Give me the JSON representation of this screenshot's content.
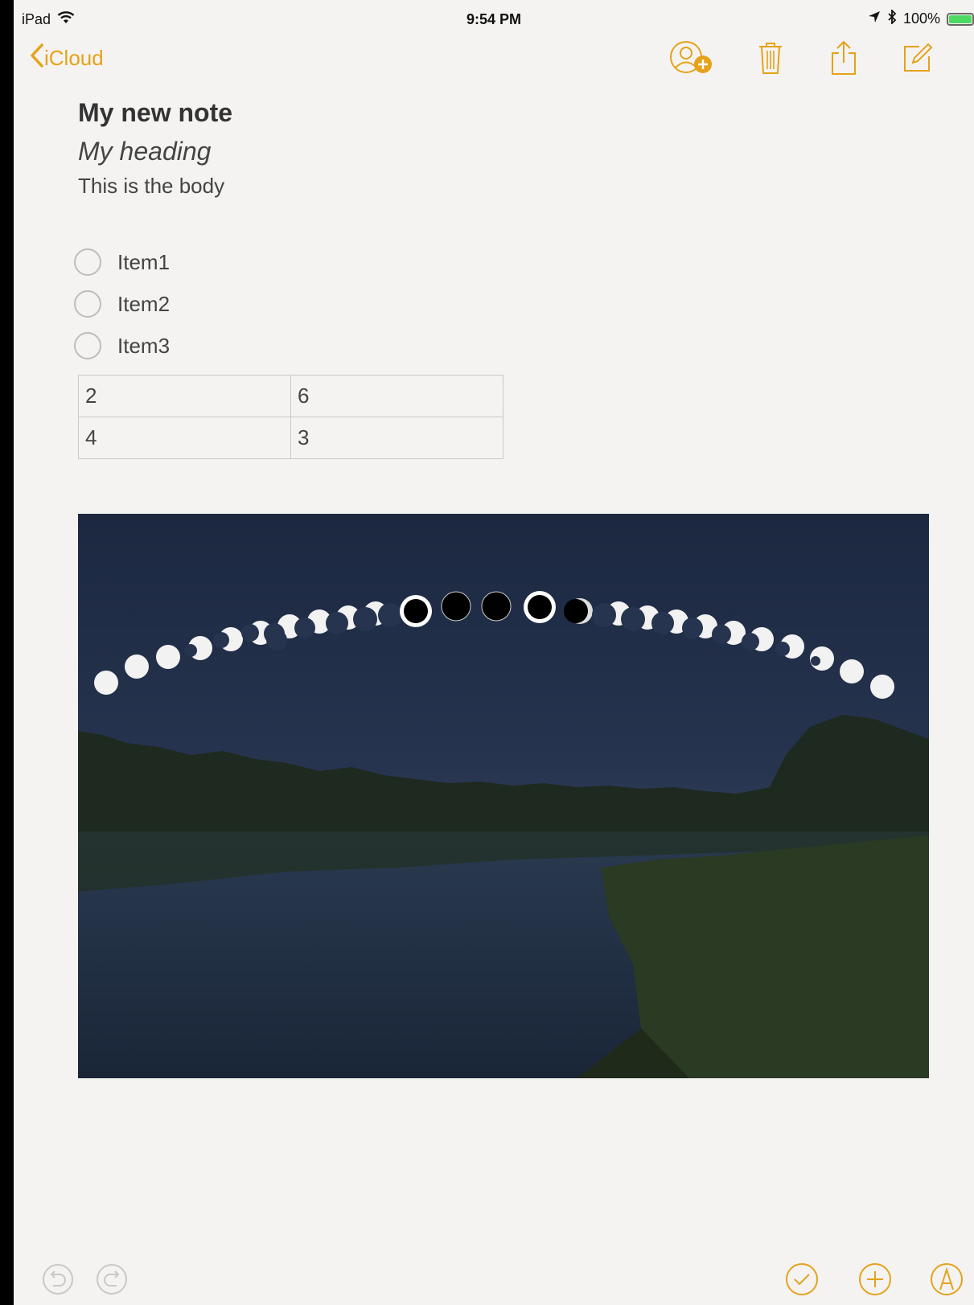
{
  "status_bar": {
    "device": "iPad",
    "time": "9:54 PM",
    "battery": "100%"
  },
  "nav": {
    "back_label": "iCloud"
  },
  "note": {
    "title": "My new note",
    "heading": "My heading",
    "body": "This is the body",
    "checklist": [
      {
        "label": "Item1",
        "checked": false
      },
      {
        "label": "Item2",
        "checked": false
      },
      {
        "label": "Item3",
        "checked": false
      }
    ],
    "table": [
      [
        "2",
        "6"
      ],
      [
        "4",
        "3"
      ]
    ]
  },
  "colors": {
    "accent": "#e5a21a",
    "paper": "#f4f3f1"
  },
  "icons": {
    "add_person": "add-person-icon",
    "trash": "trash-icon",
    "share": "share-icon",
    "compose": "compose-icon",
    "undo": "undo-icon",
    "redo": "redo-icon",
    "checklist": "checklist-icon",
    "add": "add-icon",
    "markup": "markup-icon"
  }
}
